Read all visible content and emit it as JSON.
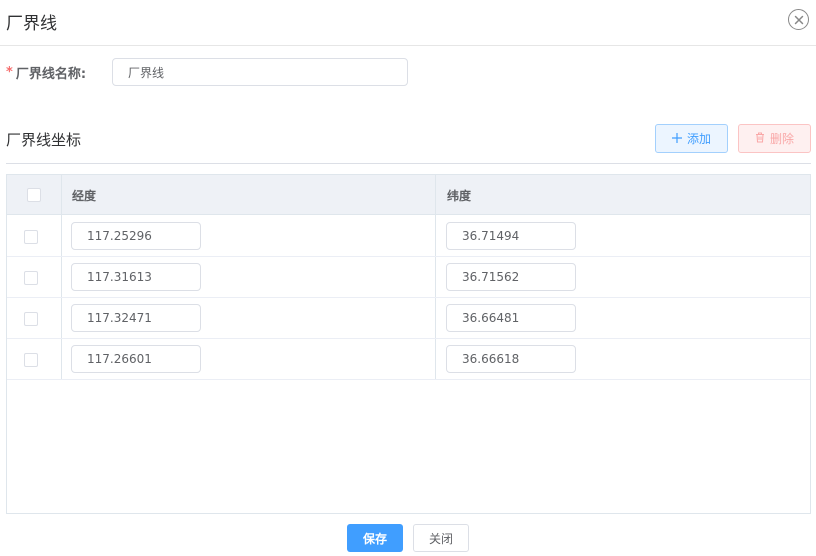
{
  "dialog": {
    "title": "厂界线",
    "close_icon": "close-circle-icon"
  },
  "form": {
    "name_required_mark": "*",
    "name_label": "厂界线名称:",
    "name_value": "厂界线"
  },
  "coords": {
    "section_title": "厂界线坐标",
    "add_icon": "plus-icon",
    "add_label": "添加",
    "delete_icon": "trash-icon",
    "delete_label": "删除",
    "columns": {
      "longitude": "经度",
      "latitude": "纬度"
    },
    "rows": [
      {
        "lng": "117.25296",
        "lat": "36.71494"
      },
      {
        "lng": "117.31613",
        "lat": "36.71562"
      },
      {
        "lng": "117.32471",
        "lat": "36.66481"
      },
      {
        "lng": "117.26601",
        "lat": "36.66618"
      }
    ]
  },
  "footer": {
    "save_label": "保存",
    "close_label": "关闭"
  },
  "colors": {
    "primary": "#409eff",
    "danger": "#f56c6c"
  }
}
